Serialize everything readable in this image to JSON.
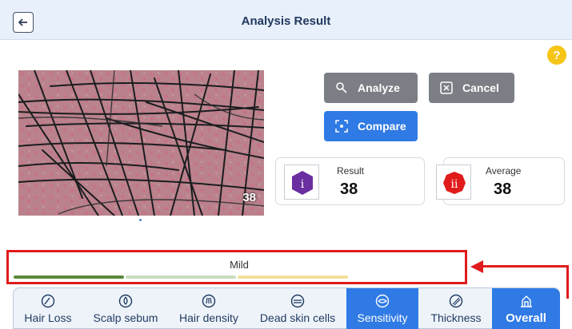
{
  "header": {
    "title": "Analysis Result",
    "back_icon": "arrow-left-icon"
  },
  "help": {
    "label": "?"
  },
  "image": {
    "count": "38"
  },
  "actions": {
    "analyze": "Analyze",
    "cancel": "Cancel",
    "compare": "Compare"
  },
  "result": {
    "label": "Result",
    "value": "38",
    "marker": "i",
    "marker_color": "#6b2fa0"
  },
  "average": {
    "label": "Average",
    "value": "38",
    "marker": "ii",
    "marker_color": "#e01b1b"
  },
  "severity": {
    "label": "Mild",
    "colors": [
      "#5a8a3a",
      "#c9dcc0",
      "#f3df9a"
    ]
  },
  "tabs": [
    {
      "label": "Hair Loss",
      "icon": "hair-loss-icon",
      "active": false
    },
    {
      "label": "Scalp sebum",
      "icon": "sebum-icon",
      "active": false
    },
    {
      "label": "Hair density",
      "icon": "density-icon",
      "active": false
    },
    {
      "label": "Dead skin cells",
      "icon": "dead-skin-icon",
      "active": false
    },
    {
      "label": "Sensitivity",
      "icon": "sensitivity-icon",
      "active": true
    },
    {
      "label": "Thickness",
      "icon": "thickness-icon",
      "active": false
    },
    {
      "label": "Overall",
      "icon": "overall-icon",
      "active": true
    }
  ],
  "colors": {
    "accent": "#2f7ae5",
    "highlight": "#e01b1b",
    "header_bg": "#e8f0fb"
  }
}
